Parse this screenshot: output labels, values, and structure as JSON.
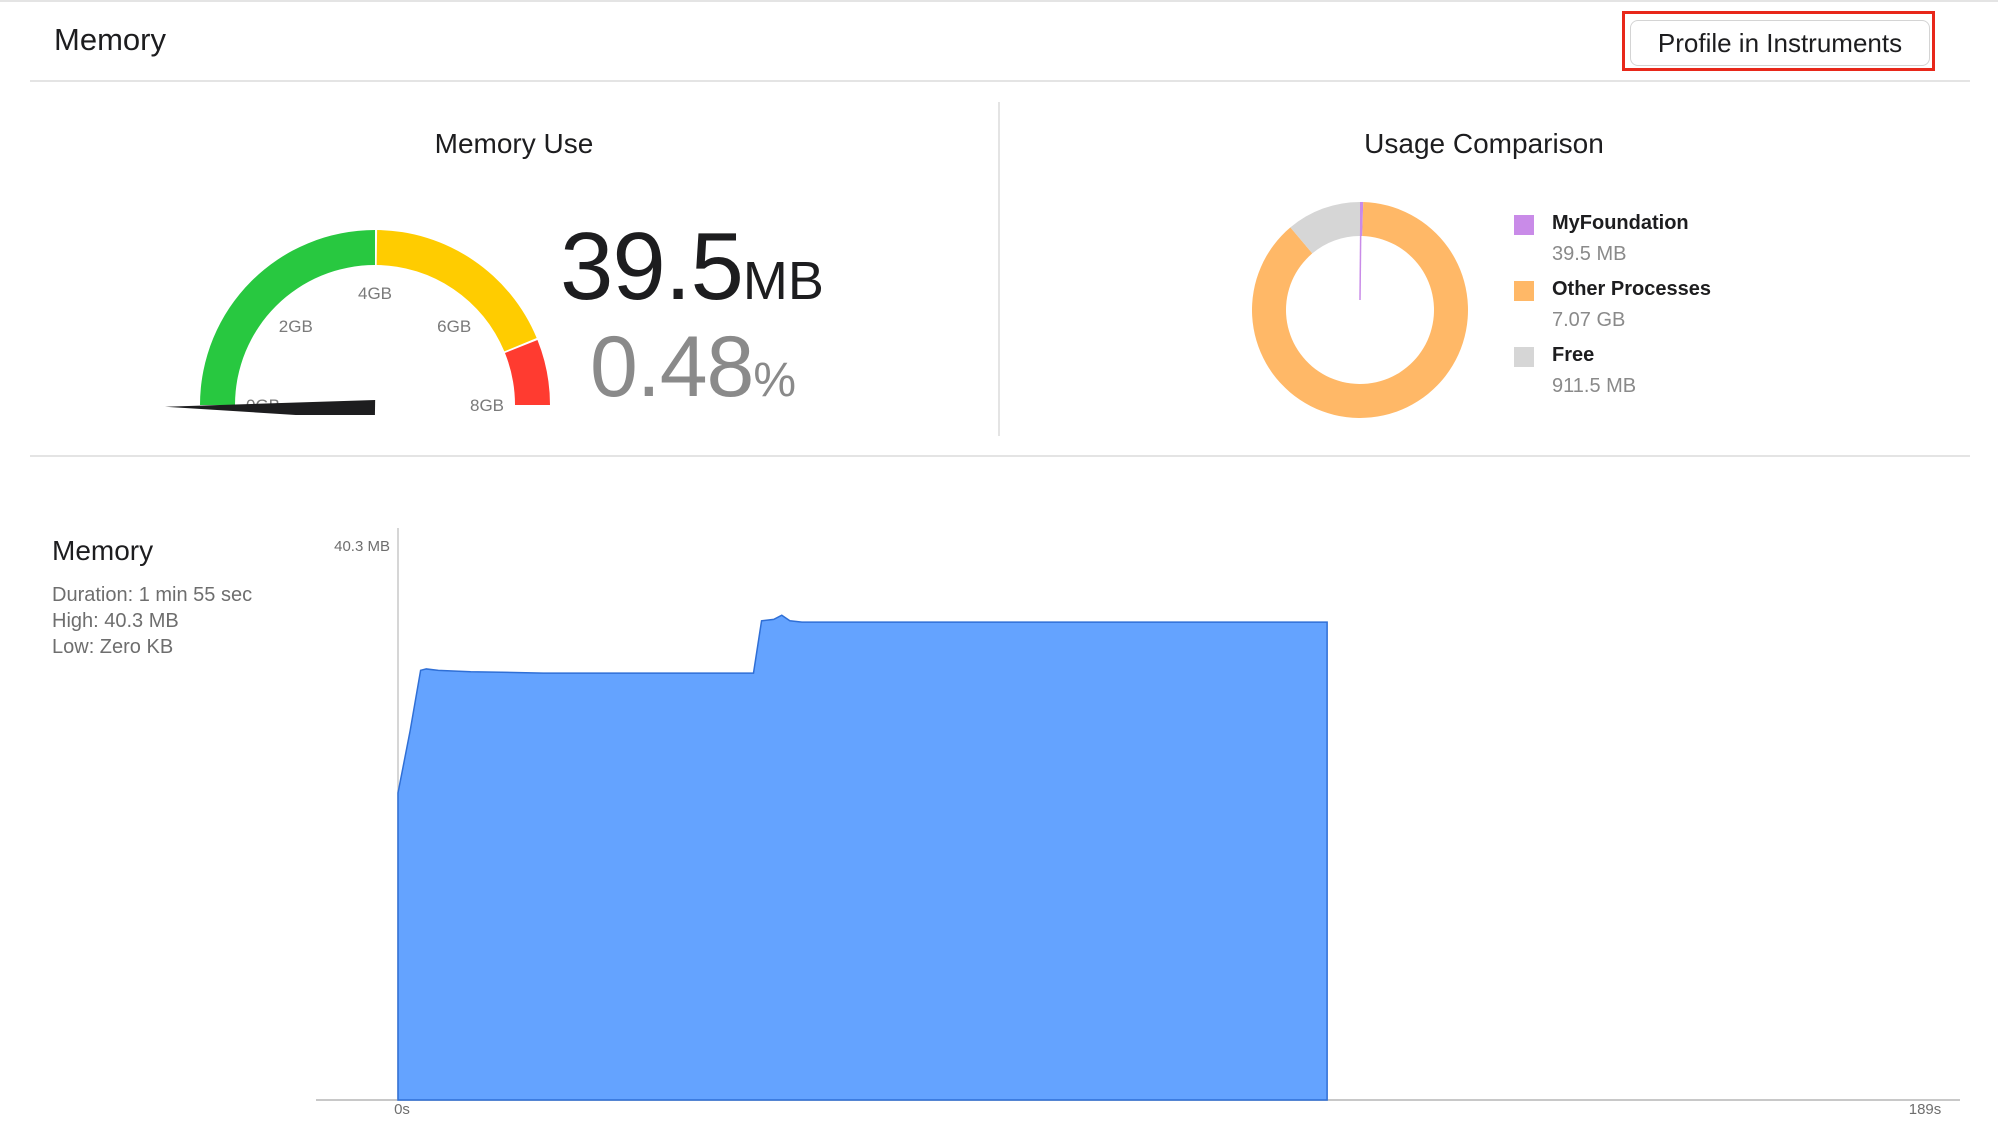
{
  "header": {
    "title": "Memory",
    "profile_button_label": "Profile in Instruments",
    "highlight_color": "#e8281a"
  },
  "memory_use": {
    "title": "Memory Use",
    "value": "39.5",
    "value_unit": "MB",
    "percent": "0.48",
    "percent_unit": "%",
    "gauge": {
      "max_gb": 8,
      "current_gb": 0.0395,
      "labels": [
        "0GB",
        "2GB",
        "4GB",
        "6GB",
        "8GB"
      ],
      "segments": [
        {
          "color": "#28c840",
          "from_gb": 0,
          "to_gb": 4
        },
        {
          "color": "#ffcc00",
          "from_gb": 4,
          "to_gb": 7
        },
        {
          "color": "#ff3b30",
          "from_gb": 7,
          "to_gb": 8
        }
      ],
      "needle_icon": "gauge-needle-icon"
    }
  },
  "usage_comparison": {
    "title": "Usage Comparison",
    "legend": [
      {
        "name": "MyFoundation",
        "value": "39.5 MB",
        "color": "#c98be8",
        "share": 0.0048
      },
      {
        "name": "Other Processes",
        "value": "7.07 GB",
        "color": "#ffb867",
        "share": 0.8837
      },
      {
        "name": "Free",
        "value": "911.5 MB",
        "color": "#d6d6d6",
        "share": 0.1115
      }
    ]
  },
  "memory_chart": {
    "title": "Memory",
    "duration": "Duration: 1 min 55 sec",
    "high": "High: 40.3 MB",
    "low": "Low: Zero KB",
    "y_max_label": "40.3 MB",
    "x_start_label": "0s",
    "x_end_label": "189s",
    "fill_color": "#64a3ff",
    "stroke_color": "#2f6fd6"
  },
  "chart_data": {
    "type": "area",
    "title": "Memory",
    "xlabel": "",
    "ylabel": "",
    "xlim": [
      0,
      189
    ],
    "ylim": [
      0,
      40.3
    ],
    "x": [
      0,
      1.5,
      2.8,
      3.5,
      5,
      9,
      18,
      44,
      45,
      46.5,
      47.5,
      48.5,
      50,
      115,
      115
    ],
    "y": [
      22.3,
      26.8,
      31.2,
      31.3,
      31.2,
      31.1,
      31.0,
      31.0,
      34.8,
      34.9,
      35.2,
      34.8,
      34.7,
      34.7,
      0
    ],
    "series": [
      {
        "name": "",
        "values": [
          22.3,
          26.8,
          31.2,
          31.3,
          31.2,
          31.1,
          31.0,
          31.0,
          34.8,
          34.9,
          35.2,
          34.8,
          34.7,
          34.7,
          0
        ]
      }
    ]
  }
}
